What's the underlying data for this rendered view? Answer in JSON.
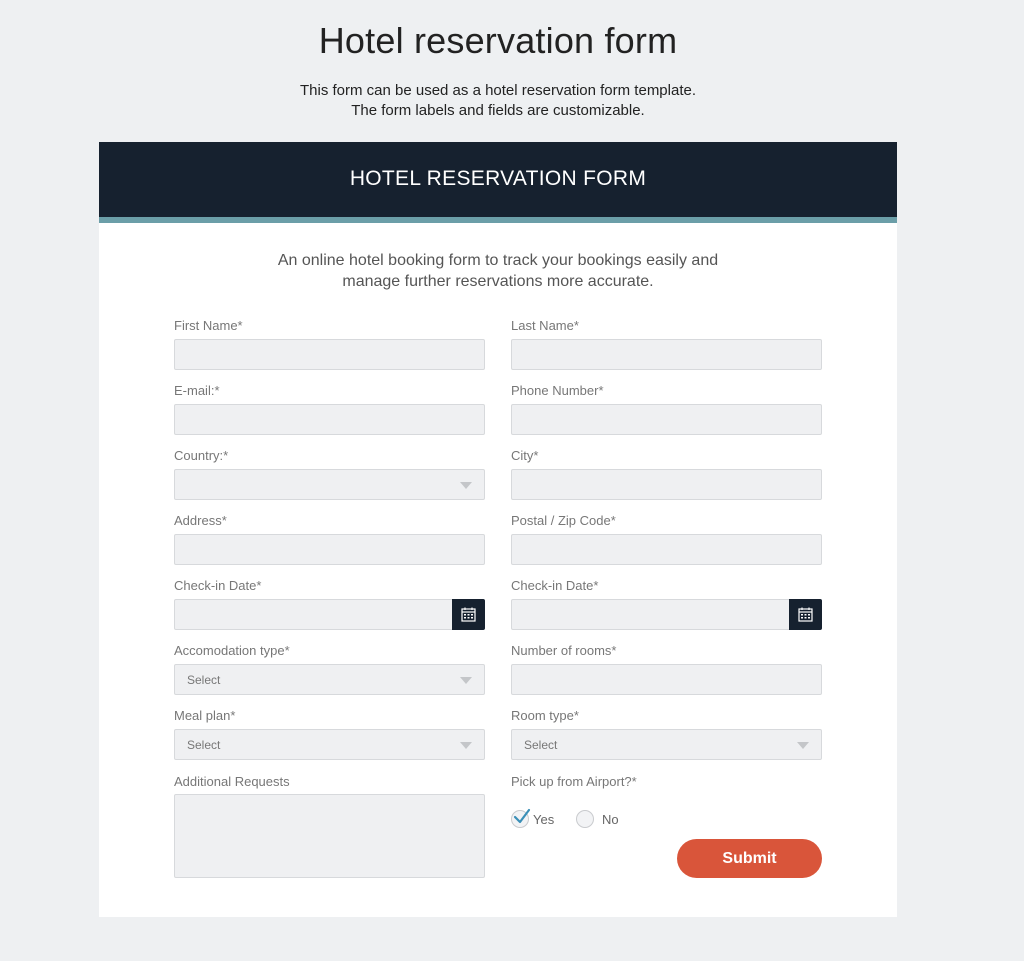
{
  "page": {
    "title": "Hotel reservation form",
    "intro_line1": "This form can be used as a hotel reservation form template.",
    "intro_line2": "The form labels and fields are customizable."
  },
  "form": {
    "header": "HOTEL RESERVATION FORM",
    "desc_line1": "An online hotel booking form to track your bookings easily and",
    "desc_line2": "manage further reservations more accurate.",
    "fields": {
      "first_name": {
        "label": "First Name*",
        "value": ""
      },
      "last_name": {
        "label": "Last Name*",
        "value": ""
      },
      "email": {
        "label": "E-mail:*",
        "value": ""
      },
      "phone": {
        "label": "Phone Number*",
        "value": ""
      },
      "country": {
        "label": "Country:*",
        "value": ""
      },
      "city": {
        "label": "City*",
        "value": ""
      },
      "address": {
        "label": "Address*",
        "value": ""
      },
      "postal": {
        "label": "Postal / Zip Code*",
        "value": ""
      },
      "checkin_1": {
        "label": "Check-in Date*",
        "value": ""
      },
      "checkin_2": {
        "label": "Check-in Date*",
        "value": ""
      },
      "accommodation": {
        "label": "Accomodation type*",
        "value": "Select"
      },
      "rooms": {
        "label": "Number of rooms*",
        "value": ""
      },
      "meal_plan": {
        "label": "Meal plan*",
        "value": "Select"
      },
      "room_type": {
        "label": "Room type*",
        "value": "Select"
      },
      "additional": {
        "label": "Additional Requests",
        "value": ""
      },
      "pickup": {
        "label": "Pick up from Airport?*",
        "yes": "Yes",
        "no": "No",
        "selected": "Yes"
      }
    },
    "submit_label": "Submit"
  },
  "colors": {
    "header_bg": "#16212f",
    "header_accent": "#6b9ea8",
    "submit": "#d9553a",
    "checkmark": "#3a8fb7"
  },
  "icons": {
    "calendar": "calendar-icon",
    "dropdown": "chevron-down-icon",
    "check": "check-icon"
  }
}
